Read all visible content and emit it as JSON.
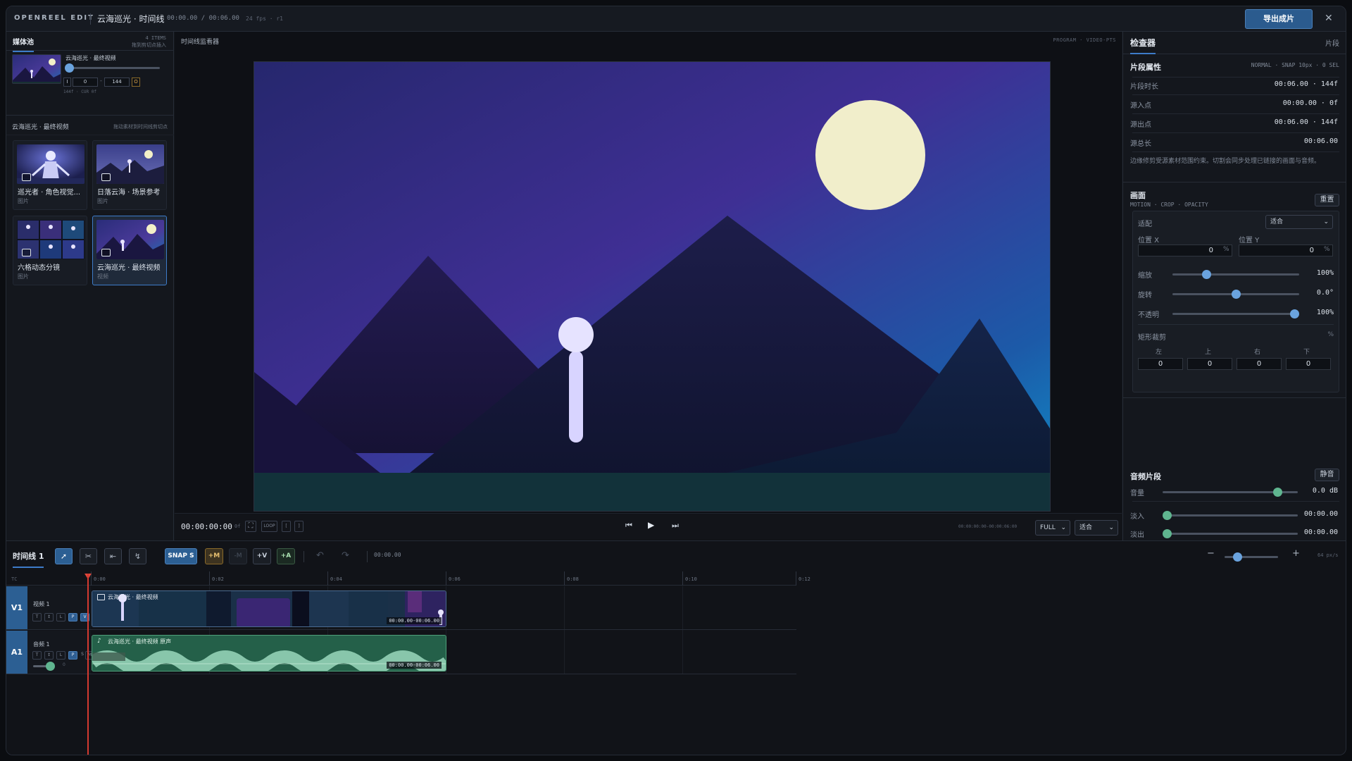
{
  "titlebar": {
    "brand": "OPENREEL EDIT",
    "project": "云海巡光 · 时间线",
    "timecode": "00:00.00 / 00:06.00",
    "fps": "24 fps · r1",
    "export_label": "导出成片",
    "close_icon": "close-icon"
  },
  "media_pool": {
    "tab": "媒体池",
    "count": "4 ITEMS",
    "hint": "拖到剪切点插入",
    "source": {
      "name": "云海巡光 · 最终视频",
      "in_btn": "I",
      "in_val": "0",
      "out_val": "144",
      "out_btn": "O",
      "dash": "-",
      "info": "144f · CUR 0f"
    },
    "pool_label": "云海巡光 · 最终视频",
    "pool_hint": "拖动素材到时间线剪切点",
    "items": [
      {
        "name": "巡光者 · 角色视觉...",
        "type": "图片"
      },
      {
        "name": "日落云海 · 场景参考",
        "type": "图片"
      },
      {
        "name": "六格动态分镜",
        "type": "图片"
      },
      {
        "name": "云海巡光 · 最终视频",
        "type": "视频"
      }
    ]
  },
  "viewer": {
    "title": "时间线监看器",
    "meta": "PROGRAM · VIDEO-PTS",
    "timecode": "00:00:00:00",
    "frame": "0f",
    "loop": "LOOP",
    "mark_in": "[",
    "mark_out": "]",
    "range": "00:00:00:00-00:00:06:00",
    "quality": "FULL",
    "fit": "适合"
  },
  "inspector": {
    "title": "检查器",
    "tab_right": "片段",
    "clip_props": {
      "title": "片段属性",
      "meta": "NORMAL · SNAP 10px · 0 SEL",
      "rows": [
        {
          "label": "片段时长",
          "value": "00:06.00 · 144f"
        },
        {
          "label": "源入点",
          "value": "00:00.00 · 0f"
        },
        {
          "label": "源出点",
          "value": "00:06.00 · 144f"
        },
        {
          "label": "源总长",
          "value": "00:06.00"
        }
      ],
      "note": "边缘修剪受源素材范围约束。切割会同步处理已链接的画面与音频。"
    },
    "frame": {
      "title": "画面",
      "sub": "MOTION · CROP · OPACITY",
      "reset": "重置",
      "fit_label": "适配",
      "fit_value": "适合",
      "posx_label": "位置 X",
      "posy_label": "位置 Y",
      "posx": "0",
      "posy": "0",
      "pct": "%",
      "scale_label": "缩放",
      "scale_val": "100%",
      "scale_level": 0.25,
      "rot_label": "旋转",
      "rot_val": "0.0°",
      "rot_level": 0.5,
      "opacity_label": "不透明",
      "opacity_val": "100%",
      "opacity_level": 1.0,
      "crop_label": "矩形裁剪",
      "crop_unit": "%",
      "crop_cols": [
        "左",
        "上",
        "右",
        "下"
      ],
      "crop_vals": [
        "0",
        "0",
        "0",
        "0"
      ]
    },
    "audio": {
      "title": "音频片段",
      "mute": "静音",
      "vol_label": "音量",
      "vol_val": "0.0 dB",
      "fadein_label": "淡入",
      "fadein_val": "00:00.00",
      "fadeout_label": "淡出",
      "fadeout_val": "00:00.00"
    }
  },
  "timeline": {
    "tab": "时间线 1",
    "snap": "SNAP S",
    "add_marker": "+M",
    "del_marker": "-M",
    "add_video": "+V",
    "add_audio": "+A",
    "timecode": "00:00.00",
    "zoom": "64 px/s",
    "ruler_label": "TC",
    "ticks": [
      "0:00",
      "0:02",
      "0:04",
      "0:06",
      "0:08",
      "0:10",
      "0:12"
    ],
    "tracks": [
      {
        "tag": "V1",
        "name": "视频 1",
        "clip": "云海巡光 · 最终视频",
        "clip_range": "00:00.00-00:06.00",
        "buttons": [
          "T",
          "↕",
          "L",
          "P",
          "V",
          "·"
        ]
      },
      {
        "tag": "A1",
        "name": "音频 1",
        "clip": "云海巡光 · 最终视频 原声",
        "clip_range": "00:00.00-00:06.00",
        "buttons": [
          "T",
          "↕",
          "L",
          "P",
          "S",
          "M"
        ],
        "vol_mark": "0"
      }
    ]
  }
}
